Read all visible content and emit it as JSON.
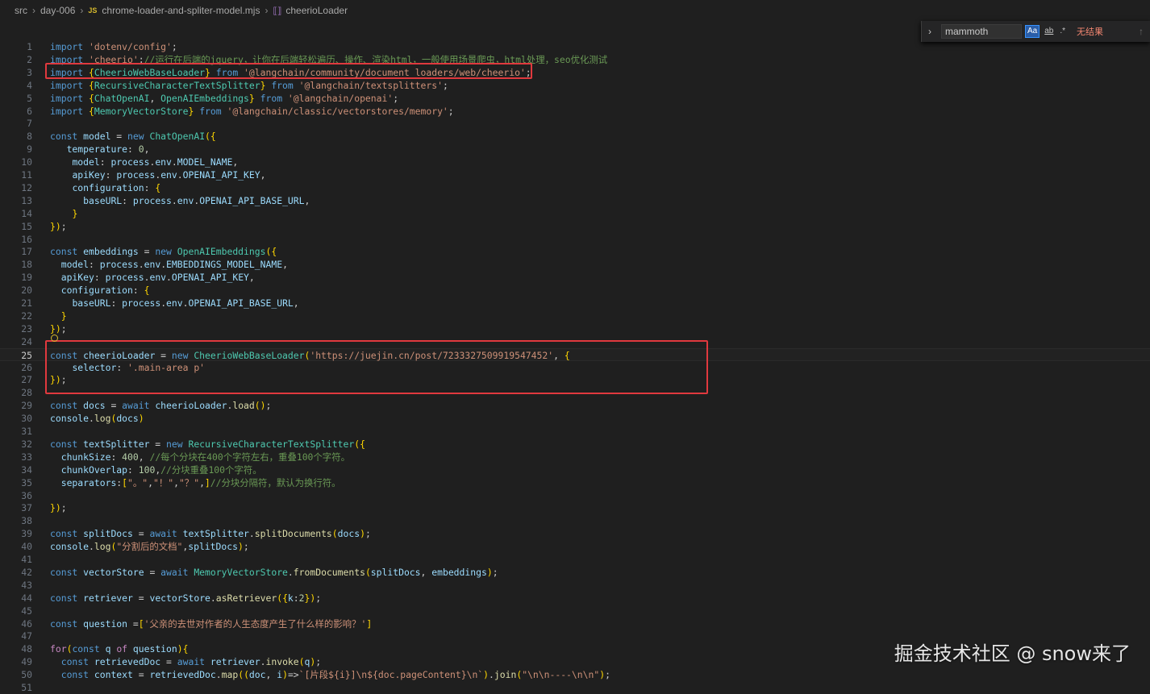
{
  "breadcrumb": {
    "parts": [
      "src",
      "day-006"
    ],
    "file_icon": "JS",
    "file": "chrome-loader-and-spliter-model.mjs",
    "symbol_icon": "variable-icon",
    "symbol": "cheerioLoader"
  },
  "find": {
    "value": "mammoth",
    "match_case": "Aa",
    "whole_word": "ab",
    "regex": ".*",
    "result": "无结果"
  },
  "code_lines": [
    {
      "n": "1",
      "t": "import 'dotenv/config';"
    },
    {
      "n": "2",
      "t": "import 'cheerio';//运行在后端的jquery，让你在后端轻松遍历、操作、渲染html，一般使用场景爬虫，html处理，seo优化测试"
    },
    {
      "n": "3",
      "t": "import {CheerioWebBaseLoader} from '@langchain/community/document_loaders/web/cheerio';"
    },
    {
      "n": "4",
      "t": "import {RecursiveCharacterTextSplitter} from '@langchain/textsplitters';"
    },
    {
      "n": "5",
      "t": "import {ChatOpenAI, OpenAIEmbeddings} from '@langchain/openai';"
    },
    {
      "n": "6",
      "t": "import {MemoryVectorStore} from '@langchain/classic/vectorstores/memory';"
    },
    {
      "n": "7",
      "t": ""
    },
    {
      "n": "8",
      "t": "const model = new ChatOpenAI({"
    },
    {
      "n": "9",
      "t": "   temperature: 0,"
    },
    {
      "n": "10",
      "t": "    model: process.env.MODEL_NAME,"
    },
    {
      "n": "11",
      "t": "    apiKey: process.env.OPENAI_API_KEY,"
    },
    {
      "n": "12",
      "t": "    configuration: {"
    },
    {
      "n": "13",
      "t": "      baseURL: process.env.OPENAI_API_BASE_URL,"
    },
    {
      "n": "14",
      "t": "    }"
    },
    {
      "n": "15",
      "t": "});"
    },
    {
      "n": "16",
      "t": ""
    },
    {
      "n": "17",
      "t": "const embeddings = new OpenAIEmbeddings({"
    },
    {
      "n": "18",
      "t": "  model: process.env.EMBEDDINGS_MODEL_NAME,"
    },
    {
      "n": "19",
      "t": "  apiKey: process.env.OPENAI_API_KEY,"
    },
    {
      "n": "20",
      "t": "  configuration: {"
    },
    {
      "n": "21",
      "t": "    baseURL: process.env.OPENAI_API_BASE_URL,"
    },
    {
      "n": "22",
      "t": "  }"
    },
    {
      "n": "23",
      "t": "});"
    },
    {
      "n": "24",
      "t": ""
    },
    {
      "n": "25",
      "t": "const cheerioLoader = new CheerioWebBaseLoader('https://juejin.cn/post/7233327509919547452', {"
    },
    {
      "n": "26",
      "t": "    selector: '.main-area p'"
    },
    {
      "n": "27",
      "t": "});"
    },
    {
      "n": "28",
      "t": ""
    },
    {
      "n": "29",
      "t": "const docs = await cheerioLoader.load();"
    },
    {
      "n": "30",
      "t": "console.log(docs)"
    },
    {
      "n": "31",
      "t": ""
    },
    {
      "n": "32",
      "t": "const textSplitter = new RecursiveCharacterTextSplitter({"
    },
    {
      "n": "33",
      "t": "  chunkSize: 400, //每个分块在400个字符左右，重叠100个字符。"
    },
    {
      "n": "34",
      "t": "  chunkOverlap: 100,//分块重叠100个字符。"
    },
    {
      "n": "35",
      "t": "  separators:[\"。\",\"！\",\"？\",]//分块分隔符，默认为换行符。"
    },
    {
      "n": "36",
      "t": ""
    },
    {
      "n": "37",
      "t": "});"
    },
    {
      "n": "38",
      "t": ""
    },
    {
      "n": "39",
      "t": "const splitDocs = await textSplitter.splitDocuments(docs);"
    },
    {
      "n": "40",
      "t": "console.log(\"分割后的文档\",splitDocs);"
    },
    {
      "n": "41",
      "t": ""
    },
    {
      "n": "42",
      "t": "const vectorStore = await MemoryVectorStore.fromDocuments(splitDocs, embeddings);"
    },
    {
      "n": "43",
      "t": ""
    },
    {
      "n": "44",
      "t": "const retriever = vectorStore.asRetriever({k:2});"
    },
    {
      "n": "45",
      "t": ""
    },
    {
      "n": "46",
      "t": "const question =['父亲的去世对作者的人生态度产生了什么样的影响？']"
    },
    {
      "n": "47",
      "t": ""
    },
    {
      "n": "48",
      "t": "for(const q of question){"
    },
    {
      "n": "49",
      "t": "  const retrievedDoc = await retriever.invoke(q);"
    },
    {
      "n": "50",
      "t": "  const context = retrievedDoc.map((doc, i)=>`[片段${i}]\\n${doc.pageContent}\\n`).join(\"\\n\\n----\\n\\n\");"
    },
    {
      "n": "51",
      "t": ""
    }
  ],
  "current_line": "25",
  "watermark": "掘金技术社区 @ snow来了",
  "colors": {
    "keyword": "#569cd6",
    "control": "#c586c0",
    "string": "#ce9178",
    "comment": "#6a9955",
    "variable": "#9cdcfe",
    "function": "#dcdcaa",
    "class": "#4ec9b0",
    "number": "#b5cea8",
    "highlight_box": "#e0393e"
  }
}
